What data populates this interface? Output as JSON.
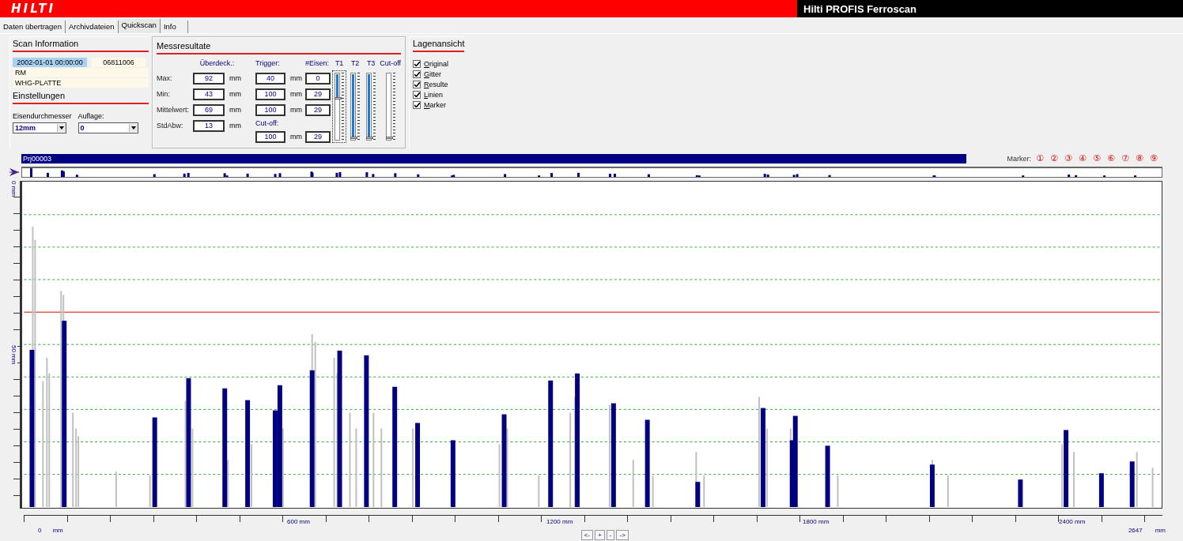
{
  "app": {
    "logo": "HILTI",
    "title": "Hilti PROFIS Ferroscan"
  },
  "tabs": [
    {
      "label": "Daten übertragen",
      "selected": false
    },
    {
      "label": "Archivdateien",
      "selected": false
    },
    {
      "label": "Quickscan",
      "selected": true
    },
    {
      "label": "Info",
      "selected": false
    }
  ],
  "scan_information": {
    "heading": "Scan Information",
    "date": "2002-01-01 00:00:00",
    "scan_id": "06811006",
    "fields": [
      "RM",
      "WHG-PLATTE"
    ]
  },
  "settings": {
    "heading": "Einstellungen",
    "dropdowns": [
      {
        "label": "Eisendurchmesser",
        "value": "12mm"
      },
      {
        "label": "Auflage:",
        "value": "0"
      }
    ]
  },
  "results": {
    "heading": "Messresultate",
    "cover_header": "Überdeck.:",
    "cover_rows": [
      {
        "label": "Max:",
        "value": "92",
        "unit": "mm"
      },
      {
        "label": "Min:",
        "value": "43",
        "unit": "mm"
      },
      {
        "label": "Mittelwert:",
        "value": "69",
        "unit": "mm"
      },
      {
        "label": "StdAbw:",
        "value": "13",
        "unit": "mm"
      }
    ],
    "trigger_header": "Trigger:",
    "count_header": "#Eisen:",
    "trigger_rows": [
      {
        "value": "40",
        "unit": "mm",
        "count": "0"
      },
      {
        "value": "100",
        "unit": "mm",
        "count": "29"
      },
      {
        "value": "100",
        "unit": "mm",
        "count": "29"
      }
    ],
    "cutoff_label": "Cut-off:",
    "cutoff_row": {
      "value": "100",
      "unit": "mm",
      "count": "29"
    },
    "sliders": [
      {
        "label": "T1",
        "level": 0.38,
        "focused": true
      },
      {
        "label": "T2",
        "level": 1,
        "focused": false
      },
      {
        "label": "T3",
        "level": 1,
        "focused": false
      },
      {
        "label": "Cut-off",
        "focused": false
      }
    ]
  },
  "layers": {
    "heading": "Lagenansicht",
    "options": [
      {
        "label": "Original",
        "checked": true
      },
      {
        "label": "Gitter",
        "checked": true
      },
      {
        "label": "Resulte",
        "checked": true
      },
      {
        "label": "Linien",
        "checked": true
      },
      {
        "label": "Marker",
        "checked": true
      }
    ]
  },
  "scan": {
    "project": "Prj00003",
    "marker_label": "Marker:",
    "markers": [
      "①",
      "②",
      "③",
      "④",
      "⑤",
      "⑥",
      "⑦",
      "⑧",
      "⑨"
    ],
    "y_labels": [
      "0 mm",
      "50 mm"
    ],
    "x_ticks": [
      "600 mm",
      "1200 mm",
      "1800 mm",
      "2400 mm"
    ],
    "x_start": "0",
    "x_start_unit": "mm",
    "x_end": "2647",
    "x_end_unit": "mm",
    "nav_buttons": [
      "<-",
      "+",
      "-",
      "->"
    ]
  }
}
